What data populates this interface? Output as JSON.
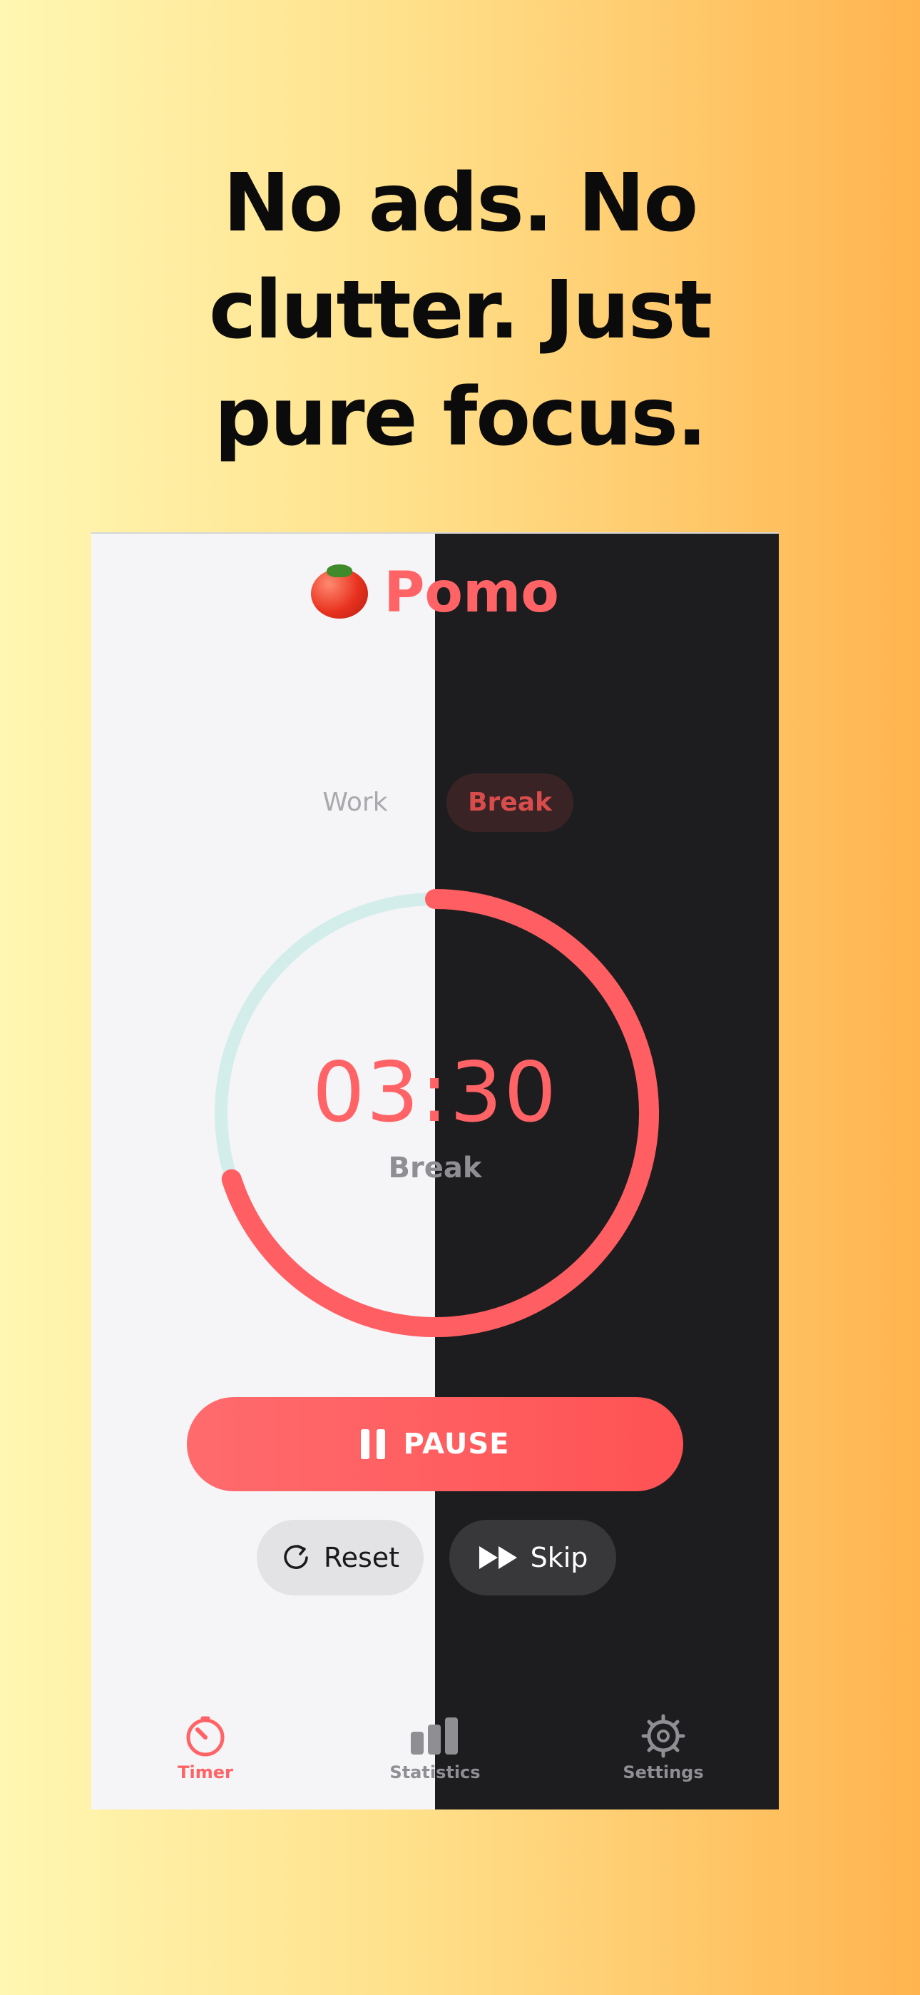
{
  "headline": {
    "lines": [
      "No ads. No",
      "clutter. Just",
      "pure focus."
    ]
  },
  "app": {
    "title": "Pomo",
    "icon": "tomato-icon",
    "accent_color": "#ff6366"
  },
  "mode_switch": {
    "options": [
      "Work",
      "Break"
    ],
    "selected": "Break"
  },
  "timer": {
    "time": "03:30",
    "label": "Break",
    "progress_fraction": 0.7
  },
  "controls": {
    "pause_label": "PAUSE",
    "reset_label": "Reset",
    "skip_label": "Skip"
  },
  "tabbar": {
    "items": [
      {
        "label": "Timer",
        "icon": "stopwatch-icon",
        "active": true
      },
      {
        "label": "Statistics",
        "icon": "bar-chart-icon",
        "active": false
      },
      {
        "label": "Settings",
        "icon": "gear-icon",
        "active": false
      }
    ]
  }
}
